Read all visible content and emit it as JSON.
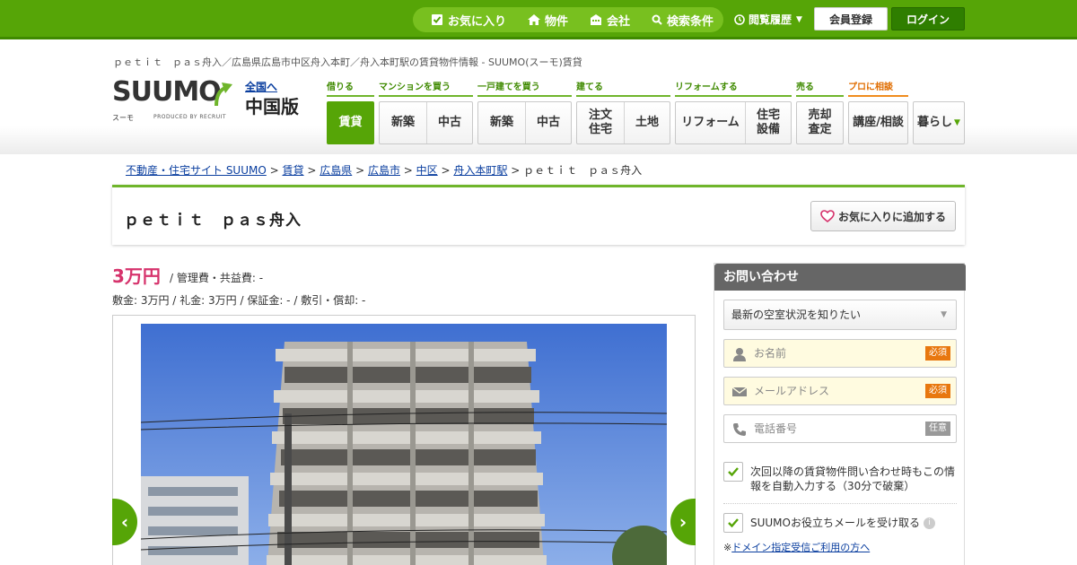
{
  "topbar": {
    "nav": [
      {
        "label": "お気に入り",
        "icon": "checkbox-icon"
      },
      {
        "label": "物件",
        "icon": "house-icon"
      },
      {
        "label": "会社",
        "icon": "building-icon"
      },
      {
        "label": "検索条件",
        "icon": "search-icon"
      }
    ],
    "history_label": "閲覧履歴",
    "register_label": "会員登録",
    "login_label": "ログイン"
  },
  "page_description": "ｐｅｔｉｔ　ｐａｓ舟入／広島県広島市中区舟入本町／舟入本町駅の賃貸物件情報 - SUUMO(スーモ)賃貸",
  "logo": {
    "text": "SUUMO",
    "sub": "スーモ",
    "produced": "PRODUCED BY RECRUIT"
  },
  "region": {
    "link": "全国へ",
    "name": "中国版"
  },
  "categories": [
    {
      "label": "借りる",
      "buttons": [
        "賃貸"
      ]
    },
    {
      "label": "マンションを買う",
      "buttons": [
        "新築",
        "中古"
      ]
    },
    {
      "label": "一戸建てを買う",
      "buttons": [
        "新築",
        "中古"
      ]
    },
    {
      "label": "建てる",
      "buttons": [
        "注文\n住宅",
        "土地"
      ]
    },
    {
      "label": "リフォームする",
      "buttons": [
        "リフォーム",
        "住宅\n設備"
      ]
    },
    {
      "label": "売る",
      "buttons": [
        "売却\n査定"
      ]
    },
    {
      "label": "プロに相談",
      "buttons": [
        "講座/相談"
      ]
    },
    {
      "label": "",
      "buttons": [
        "暮らし"
      ]
    }
  ],
  "breadcrumb": {
    "items": [
      "不動産・住宅サイト SUUMO",
      "賃貸",
      "広島県",
      "広島市",
      "中区",
      "舟入本町駅"
    ],
    "current": "ｐｅｔｉｔ　ｐａｓ舟入"
  },
  "property": {
    "title": "ｐｅｔｉｔ　ｐａｓ舟入",
    "favorite_button": "お気に入りに追加する",
    "rent": "3万円",
    "management_fee": "/ 管理費・共益費: -",
    "details": "敷金: 3万円  / 礼金: 3万円  / 保証金: -  / 敷引・償却: -"
  },
  "contact": {
    "header": "お問い合わせ",
    "select_value": "最新の空室状況を知りたい",
    "fields": [
      {
        "placeholder": "お名前",
        "badge": "必須",
        "icon": "person-icon"
      },
      {
        "placeholder": "メールアドレス",
        "badge": "必須",
        "icon": "mail-icon"
      },
      {
        "placeholder": "電話番号",
        "badge": "任意",
        "icon": "phone-icon"
      }
    ],
    "checkbox1": "次回以降の賃貸物件問い合わせ時もこの情報を自動入力する（30分で破棄）",
    "checkbox2": "SUUMOお役立ちメールを受け取る",
    "domain_prefix": "※",
    "domain_link": "ドメイン指定受信ご利用の方へ"
  },
  "colors": {
    "brand_green": "#56a507",
    "price_pink": "#d6336c",
    "required_orange": "#e8770e"
  }
}
